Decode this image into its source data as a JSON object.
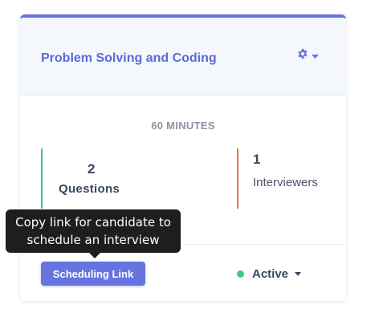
{
  "card": {
    "title": "Problem Solving and Coding",
    "duration": "60 MINUTES",
    "questions": {
      "count": "2",
      "label": "Questions"
    },
    "interviewers": {
      "count": "1",
      "label": "Interviewers"
    },
    "scheduling_button": "Scheduling Link",
    "status": "Active",
    "icons": {
      "settings": "gear-icon",
      "settings_caret": "chevron-down-icon",
      "status_caret": "chevron-down-icon"
    }
  },
  "tooltip": {
    "line1": "Copy link for candidate to",
    "line2": "schedule an interview"
  },
  "colors": {
    "accent": "#6674e0",
    "questions_border": "#3ec98a",
    "interviewers_border": "#f0724a",
    "status_active": "#3ec98a"
  }
}
